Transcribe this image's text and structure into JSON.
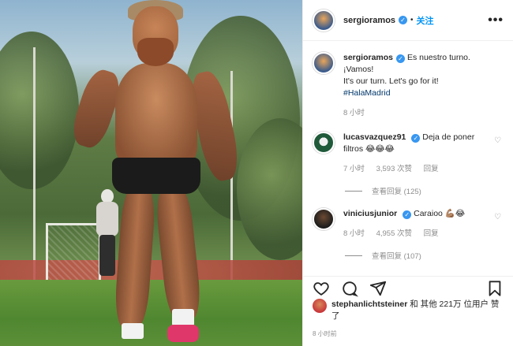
{
  "post": {
    "author": "sergioramos",
    "follow_label": "关注",
    "more_label": "•••",
    "verified_glyph": "✓",
    "caption_lines": [
      "Es nuestro turno.",
      "¡Vamos!",
      "It's our turn. Let's go for it!"
    ],
    "hashtag": "#HalaMadrid",
    "caption_time": "8 小时"
  },
  "comments": [
    {
      "user": "lucasvazquez91",
      "text": "Deja de poner filtros 😂😂😂",
      "time": "7 小时",
      "likes": "3,593 次赞",
      "reply": "回复",
      "view_replies": "查看回复 (125)"
    },
    {
      "user": "viniciusjunior",
      "text": "Caraioo 💪🏽😂",
      "time": "8 小时",
      "likes": "4,955 次赞",
      "reply": "回复",
      "view_replies": "查看回复 (107)"
    }
  ],
  "likes": {
    "user": "stephanlichtsteiner",
    "rest": "和 其他 221万 位用户 赞了"
  },
  "timestamp": "8 小时前",
  "icons": [
    "heart-icon",
    "comment-icon",
    "share-icon",
    "bookmark-icon"
  ]
}
